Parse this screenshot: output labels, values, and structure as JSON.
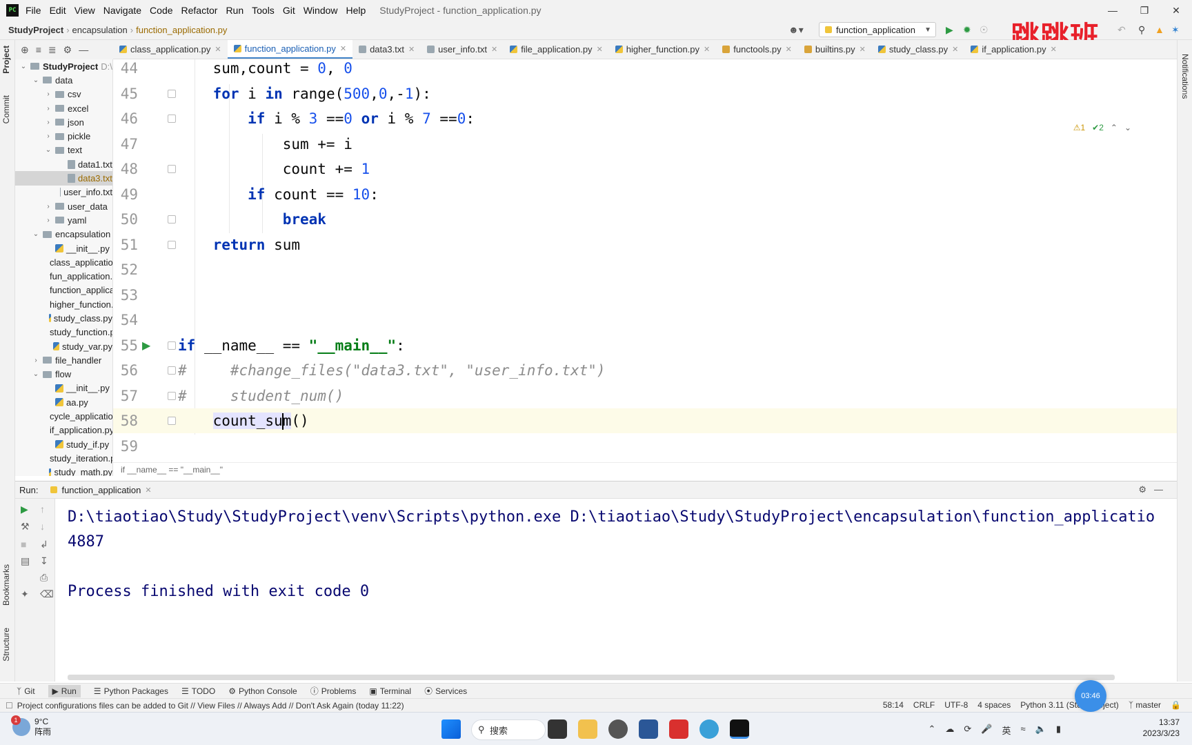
{
  "menubar": {
    "items": [
      "File",
      "Edit",
      "View",
      "Navigate",
      "Code",
      "Refactor",
      "Run",
      "Tools",
      "Git",
      "Window",
      "Help"
    ],
    "title": "StudyProject - function_application.py"
  },
  "breadcrumb": {
    "project": "StudyProject",
    "folder": "encapsulation",
    "file": "function_application.py"
  },
  "run_config": {
    "label": "function_application"
  },
  "watermark": "跳跳班",
  "left_strip": {
    "project": "Project",
    "commit": "Commit",
    "bookmarks": "Bookmarks",
    "structure": "Structure"
  },
  "right_strip": {
    "notifications": "Notifications"
  },
  "tree": [
    {
      "label": "StudyProject",
      "suffix": "D:\\",
      "depth": 0,
      "type": "root",
      "open": true
    },
    {
      "label": "data",
      "depth": 1,
      "type": "folder",
      "open": true
    },
    {
      "label": "csv",
      "depth": 2,
      "type": "folder",
      "open": false
    },
    {
      "label": "excel",
      "depth": 2,
      "type": "folder",
      "open": false
    },
    {
      "label": "json",
      "depth": 2,
      "type": "folder",
      "open": false
    },
    {
      "label": "pickle",
      "depth": 2,
      "type": "folder",
      "open": false
    },
    {
      "label": "text",
      "depth": 2,
      "type": "folder",
      "open": true
    },
    {
      "label": "data1.txt",
      "depth": 3,
      "type": "txt"
    },
    {
      "label": "data3.txt",
      "depth": 3,
      "type": "txt",
      "selected": true
    },
    {
      "label": "user_info.txt",
      "depth": 3,
      "type": "txt"
    },
    {
      "label": "user_data",
      "depth": 2,
      "type": "folder",
      "open": false
    },
    {
      "label": "yaml",
      "depth": 2,
      "type": "folder",
      "open": false
    },
    {
      "label": "encapsulation",
      "depth": 1,
      "type": "folder",
      "open": true
    },
    {
      "label": "__init__.py",
      "depth": 2,
      "type": "py"
    },
    {
      "label": "class_application.py",
      "depth": 2,
      "type": "py"
    },
    {
      "label": "fun_application.py",
      "depth": 2,
      "type": "py"
    },
    {
      "label": "function_application.py",
      "depth": 2,
      "type": "py"
    },
    {
      "label": "higher_function.py",
      "depth": 2,
      "type": "py"
    },
    {
      "label": "study_class.py",
      "depth": 2,
      "type": "py"
    },
    {
      "label": "study_function.py",
      "depth": 2,
      "type": "py"
    },
    {
      "label": "study_var.py",
      "depth": 2,
      "type": "py"
    },
    {
      "label": "file_handler",
      "depth": 1,
      "type": "folder",
      "open": false
    },
    {
      "label": "flow",
      "depth": 1,
      "type": "folder",
      "open": true
    },
    {
      "label": "__init__.py",
      "depth": 2,
      "type": "py"
    },
    {
      "label": "aa.py",
      "depth": 2,
      "type": "py"
    },
    {
      "label": "cycle_application.py",
      "depth": 2,
      "type": "py"
    },
    {
      "label": "if_application.py",
      "depth": 2,
      "type": "py"
    },
    {
      "label": "study_if.py",
      "depth": 2,
      "type": "py"
    },
    {
      "label": "study_iteration.py",
      "depth": 2,
      "type": "py"
    },
    {
      "label": "study_math.py",
      "depth": 2,
      "type": "py"
    }
  ],
  "tabs": [
    {
      "label": "class_application.py",
      "icon": "py"
    },
    {
      "label": "function_application.py",
      "icon": "py",
      "active": true
    },
    {
      "label": "data3.txt",
      "icon": "txt"
    },
    {
      "label": "user_info.txt",
      "icon": "txt"
    },
    {
      "label": "file_application.py",
      "icon": "py"
    },
    {
      "label": "higher_function.py",
      "icon": "py"
    },
    {
      "label": "functools.py",
      "icon": "fn"
    },
    {
      "label": "builtins.py",
      "icon": "fn"
    },
    {
      "label": "study_class.py",
      "icon": "py"
    },
    {
      "label": "if_application.py",
      "icon": "py"
    }
  ],
  "editor_status": {
    "warnings": "⚠1",
    "checks": "✔2"
  },
  "code_lines": [
    {
      "n": "44",
      "html": "    sum,count = <span class=\"num\">0</span>, <span class=\"num\">0</span>",
      "fold": false
    },
    {
      "n": "45",
      "html": "    <span class=\"kw\">for</span> i <span class=\"kw\">in</span> range(<span class=\"num\">500</span>,<span class=\"num\">0</span>,-<span class=\"num\">1</span>):",
      "fold": true
    },
    {
      "n": "46",
      "html": "        <span class=\"kw\">if</span> i % <span class=\"num\">3</span> ==<span class=\"num\">0</span> <span class=\"kw\">or</span> i % <span class=\"num\">7</span> ==<span class=\"num\">0</span>:",
      "fold": true
    },
    {
      "n": "47",
      "html": "            sum += i",
      "fold": false
    },
    {
      "n": "48",
      "html": "            count += <span class=\"num\">1</span>",
      "fold": true
    },
    {
      "n": "49",
      "html": "        <span class=\"kw\">if</span> count == <span class=\"num\">10</span>:",
      "fold": false
    },
    {
      "n": "50",
      "html": "            <span class=\"kw\">break</span>",
      "fold": true
    },
    {
      "n": "51",
      "html": "    <span class=\"kw\">return</span> sum",
      "fold": true
    },
    {
      "n": "52",
      "html": "",
      "fold": false
    },
    {
      "n": "53",
      "html": "",
      "fold": false
    },
    {
      "n": "54",
      "html": "",
      "fold": false
    },
    {
      "n": "55",
      "html": "<span class=\"kw\">if</span> __name__ == <span class=\"str\">\"__main__\"</span>:",
      "fold": true,
      "run": true
    },
    {
      "n": "56",
      "html": "<span class=\"cmt\">#     #change_files(\"data3.txt\", \"user_info.txt\")</span>",
      "fold": true
    },
    {
      "n": "57",
      "html": "<span class=\"cmt\">#     student_num()</span>",
      "fold": true
    },
    {
      "n": "58",
      "html": "    <span class=\"hl\">count_su<span class=\"caret\"></span>m</span>()",
      "fold": true,
      "current": true
    },
    {
      "n": "59",
      "html": "",
      "fold": false
    }
  ],
  "editor_crumb": "if __name__ == \"__main__\"",
  "run_panel": {
    "label": "Run:",
    "tab": "function_application"
  },
  "console": [
    "D:\\tiaotiao\\Study\\StudyProject\\venv\\Scripts\\python.exe D:\\tiaotiao\\Study\\StudyProject\\encapsulation\\function_applicatio",
    "4887",
    "",
    "Process finished with exit code 0"
  ],
  "bottom_tabs": [
    "Git",
    "Run",
    "Python Packages",
    "TODO",
    "Python Console",
    "Problems",
    "Terminal",
    "Services"
  ],
  "status": {
    "message": "Project configurations files can be added to Git // View Files // Always Add // Don't Ask Again (today 11:22)",
    "position": "58:14",
    "eol": "CRLF",
    "encoding": "UTF-8",
    "indent": "4 spaces",
    "interpreter": "Python 3.11 (StudyProject)",
    "branch": "master"
  },
  "timer": "03:46",
  "taskbar": {
    "weather_temp": "9°C",
    "weather_desc": "阵雨",
    "weather_badge": "1",
    "search": "搜索",
    "ime": "英",
    "time": "13:37",
    "date": "2023/3/23"
  }
}
